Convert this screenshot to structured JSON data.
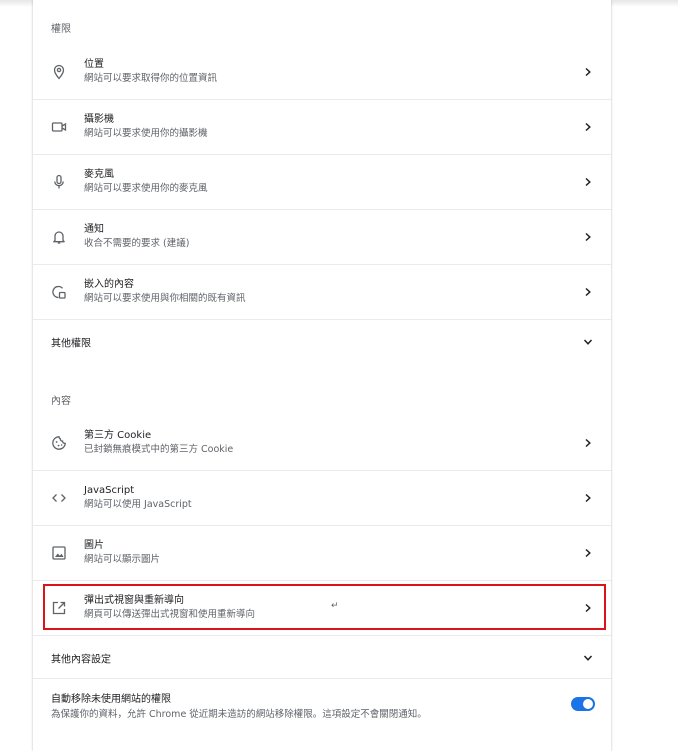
{
  "permissions": {
    "header": "權限",
    "items": [
      {
        "icon": "location-pin-icon",
        "title": "位置",
        "subtitle": "網站可以要求取得你的位置資訊"
      },
      {
        "icon": "video-camera-icon",
        "title": "攝影機",
        "subtitle": "網站可以要求使用你的攝影機"
      },
      {
        "icon": "microphone-icon",
        "title": "麥克風",
        "subtitle": "網站可以要求使用你的麥克風"
      },
      {
        "icon": "bell-icon",
        "title": "通知",
        "subtitle": "收合不需要的要求 (建議)"
      },
      {
        "icon": "embedded-content-icon",
        "title": "嵌入的內容",
        "subtitle": "網站可以要求使用與你相關的既有資訊"
      }
    ],
    "more_label": "其他權限"
  },
  "content": {
    "header": "內容",
    "items": [
      {
        "icon": "cookie-icon",
        "title": "第三方 Cookie",
        "subtitle": "已封鎖無痕模式中的第三方 Cookie"
      },
      {
        "icon": "code-brackets-icon",
        "title": "JavaScript",
        "subtitle": "網站可以使用 JavaScript"
      },
      {
        "icon": "image-icon",
        "title": "圖片",
        "subtitle": "網站可以顯示圖片"
      },
      {
        "icon": "open-external-icon",
        "title": "彈出式視窗與重新導向",
        "subtitle": "網頁可以傳送彈出式視窗和使用重新導向"
      }
    ],
    "more_label": "其他內容設定"
  },
  "auto_remove": {
    "title": "自動移除未使用網站的權限",
    "subtitle": "為保護你的資料，允許 Chrome 從近期未造訪的網站移除權限。這項設定不會關閉通知。",
    "enabled": true
  },
  "colors": {
    "accent": "#1a73e8",
    "highlight": "#d9141b"
  }
}
